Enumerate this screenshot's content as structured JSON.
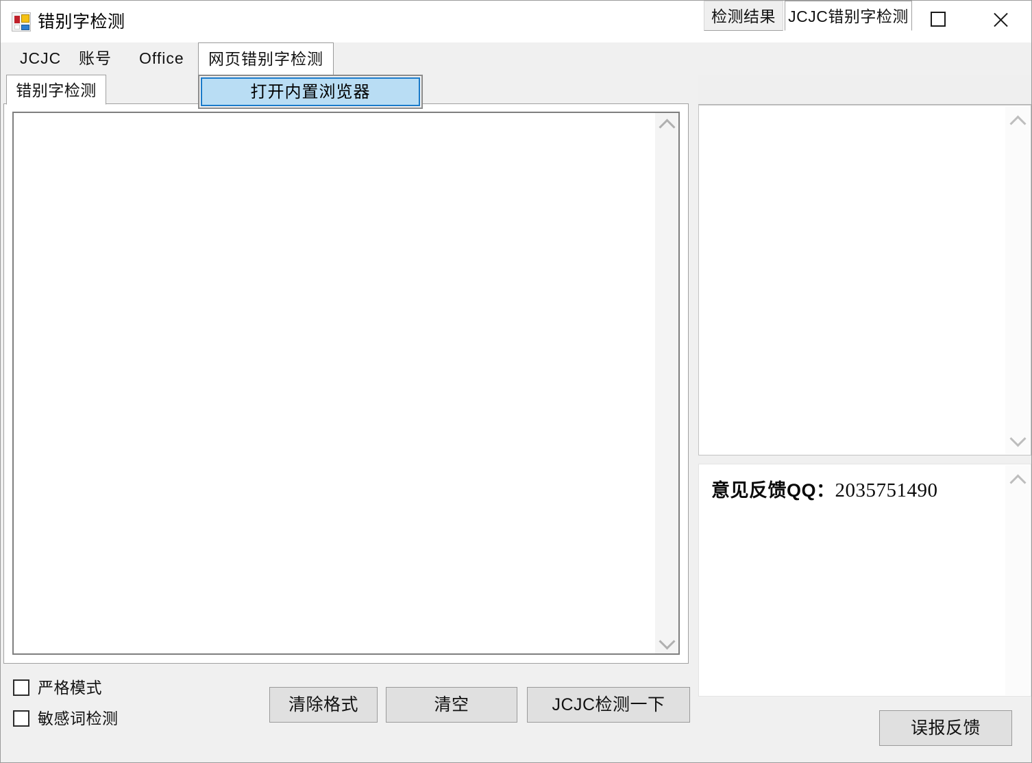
{
  "window": {
    "title": "错别字检测",
    "icon": "app-grid-icon",
    "controls": {
      "minimize": "minimize-icon",
      "maximize": "maximize-icon",
      "close": "close-icon"
    }
  },
  "menubar": {
    "items": [
      {
        "label": "JCJC"
      },
      {
        "label": "账号"
      },
      {
        "label": "Office"
      },
      {
        "label": "网页错别字检测",
        "open": true
      }
    ]
  },
  "dropdown": {
    "open": true,
    "items": [
      {
        "label": "打开内置浏览器",
        "highlighted": true
      }
    ]
  },
  "left_panel": {
    "tabs": [
      {
        "label": "错别字检测",
        "selected": true
      }
    ],
    "editor": {
      "value": "",
      "placeholder": ""
    }
  },
  "options": {
    "checkboxes": [
      {
        "label": "严格模式",
        "checked": false
      },
      {
        "label": "敏感词检测",
        "checked": false
      }
    ]
  },
  "actions": {
    "clear_format": "清除格式",
    "clear": "清空",
    "detect": "JCJC检测一下",
    "report_false_positive": "误报反馈"
  },
  "right_panel": {
    "tabs": [
      {
        "label": "检测结果",
        "selected": false
      },
      {
        "label": "JCJC错别字检测",
        "selected": true
      }
    ],
    "results": {
      "value": ""
    },
    "feedback": {
      "label": "意见反馈QQ：",
      "qq": "2035751490"
    }
  },
  "colors": {
    "window_bg": "#f0f0f0",
    "titlebar_bg": "#ffffff",
    "panel_bg": "#ffffff",
    "highlight_fill": "#b9ddf4",
    "highlight_border": "#1a7ac9",
    "button_bg": "#e0e0e0",
    "border": "#9a9a9a"
  }
}
